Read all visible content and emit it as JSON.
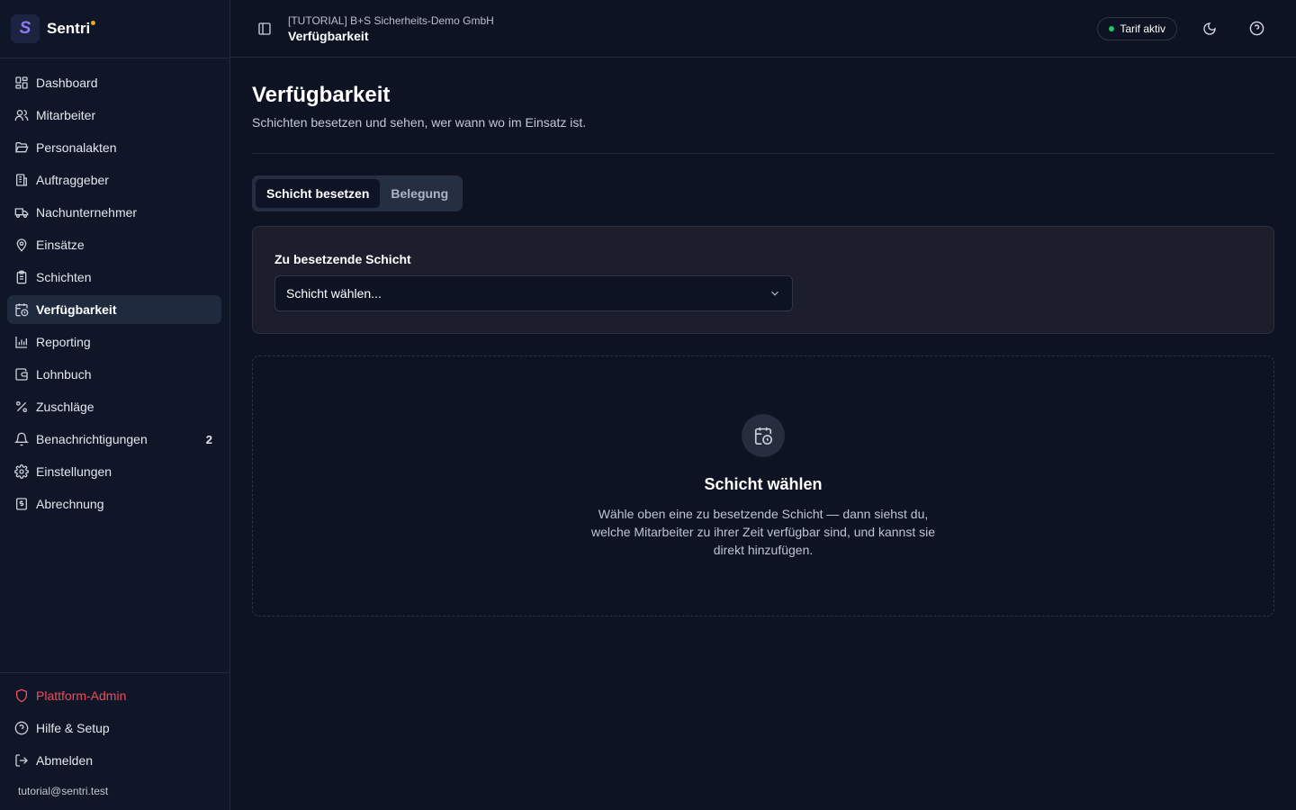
{
  "brand": {
    "name": "Sentri",
    "logo_letter": "S"
  },
  "sidebar": {
    "items": [
      {
        "label": "Dashboard",
        "icon": "dashboard-icon"
      },
      {
        "label": "Mitarbeiter",
        "icon": "users-icon"
      },
      {
        "label": "Personalakten",
        "icon": "folder-open-icon"
      },
      {
        "label": "Auftraggeber",
        "icon": "building-icon"
      },
      {
        "label": "Nachunternehmer",
        "icon": "truck-icon"
      },
      {
        "label": "Einsätze",
        "icon": "map-pin-icon"
      },
      {
        "label": "Schichten",
        "icon": "clipboard-icon"
      },
      {
        "label": "Verfügbarkeit",
        "icon": "calendar-clock-icon",
        "active": true
      },
      {
        "label": "Reporting",
        "icon": "bar-chart-icon"
      },
      {
        "label": "Lohnbuch",
        "icon": "wallet-icon"
      },
      {
        "label": "Zuschläge",
        "icon": "percent-icon"
      },
      {
        "label": "Benachrichtigungen",
        "icon": "bell-icon",
        "count": "2"
      },
      {
        "label": "Einstellungen",
        "icon": "gear-icon"
      },
      {
        "label": "Abrechnung",
        "icon": "receipt-icon"
      }
    ],
    "bottom": {
      "admin": "Plattform-Admin",
      "help": "Hilfe & Setup",
      "logout": "Abmelden",
      "email": "tutorial@sentri.test"
    }
  },
  "header": {
    "org": "[TUTORIAL] B+S Sicherheits-Demo GmbH",
    "page": "Verfügbarkeit",
    "tarif": "Tarif aktiv"
  },
  "main": {
    "title": "Verfügbarkeit",
    "subtitle": "Schichten besetzen und sehen, wer wann wo im Einsatz ist.",
    "tabs": [
      {
        "label": "Schicht besetzen",
        "active": true
      },
      {
        "label": "Belegung",
        "active": false
      }
    ],
    "field_label": "Zu besetzende Schicht",
    "select_value": "Schicht wählen...",
    "empty_title": "Schicht wählen",
    "empty_text": "Wähle oben eine zu besetzende Schicht — dann siehst du, welche Mitarbeiter zu ihrer Zeit verfügbar sind, und kannst sie direkt hinzufügen."
  },
  "colors": {
    "background": "#0d1323",
    "sidebar": "#0f1627",
    "accent": "#8b7cf6",
    "danger": "#ef4c5a",
    "status_ok": "#22c55e"
  }
}
